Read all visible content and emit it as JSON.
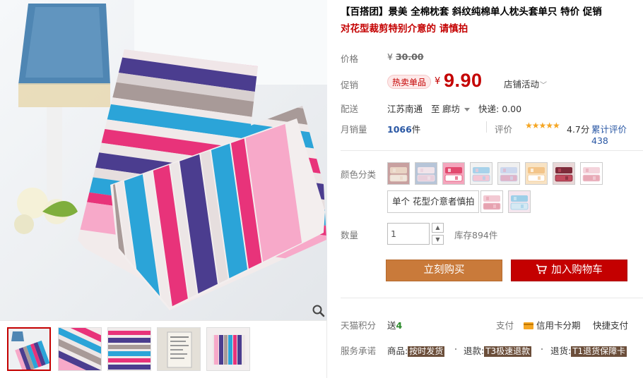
{
  "product": {
    "title": "【百搭团】景美 全棉枕套 斜纹纯棉单人枕头套单只 特价 促销",
    "subtitle": "对花型裁剪特别介意的 请慎拍"
  },
  "price": {
    "label": "价格",
    "currency": "¥",
    "original": "30.00"
  },
  "promo": {
    "label": "促销",
    "badge": "热卖单品",
    "currency": "¥",
    "price": "9.90",
    "shop_event": "店铺活动",
    "chevron": "﹀"
  },
  "shipping": {
    "label": "配送",
    "from": "江苏南通",
    "to_word": "至",
    "to": "廊坊",
    "fee_label": "快递:",
    "fee": "0.00"
  },
  "sales": {
    "label": "月销量",
    "count": "1066",
    "unit": "件",
    "rating_label": "评价",
    "stars": "★★★★★",
    "score": "4.7分",
    "reviews": "累计评价438"
  },
  "sku": {
    "label": "颜色分类",
    "text_option": "单个 花型介意者慎拍",
    "swatches": [
      {
        "name": "swatch-1",
        "colors": [
          "#e9d4c4",
          "#c8a0a0",
          "#f0e6dc"
        ]
      },
      {
        "name": "swatch-2",
        "colors": [
          "#f1e4ea",
          "#b7c5d8",
          "#e8d0dc"
        ]
      },
      {
        "name": "swatch-3",
        "colors": [
          "#e24a6f",
          "#f4a6bd",
          "#ffffff"
        ]
      },
      {
        "name": "swatch-4",
        "colors": [
          "#a8d2ea",
          "#f2f2f2",
          "#f4c6d4"
        ]
      },
      {
        "name": "swatch-5",
        "colors": [
          "#cdd8ee",
          "#f0f0f0",
          "#e0b3c8"
        ]
      },
      {
        "name": "swatch-6",
        "colors": [
          "#f3c58a",
          "#f8e3c4",
          "#ffffff"
        ]
      },
      {
        "name": "swatch-7",
        "colors": [
          "#7e2b3a",
          "#e9d7d7",
          "#c24a5d"
        ]
      },
      {
        "name": "swatch-8",
        "colors": [
          "#f4d4dc",
          "#ffffff",
          "#e8a9b6"
        ]
      },
      {
        "name": "swatch-9",
        "colors": [
          "#f3c9d3",
          "#ffffff",
          "#e6a2b0"
        ]
      },
      {
        "name": "swatch-10",
        "colors": [
          "#9ecfe8",
          "#f5e6ee",
          "#d5e9f3"
        ]
      }
    ]
  },
  "quantity": {
    "label": "数量",
    "value": "1",
    "up": "▲",
    "down": "▼",
    "stock": "库存894件"
  },
  "actions": {
    "buy_now": "立刻购买",
    "add_to_cart": "加入购物车"
  },
  "service": {
    "points_label": "天猫积分",
    "points_prefix": "送",
    "points_value": "4",
    "pay_label": "支付",
    "pay_card": "信用卡分期",
    "pay_quick": "快捷支付",
    "promise_label": "服务承诺",
    "promises": [
      {
        "prefix": "商品:",
        "tag": "按时发货"
      },
      {
        "prefix": "退款:",
        "tag": "T3极速退款"
      },
      {
        "prefix": "退货:",
        "tag": "T1退货保障卡"
      }
    ]
  },
  "colors": {
    "accent_red": "#c40000",
    "buy_brown": "#c97a3a",
    "link_blue": "#2957a4",
    "star_orange": "#f5a623"
  }
}
